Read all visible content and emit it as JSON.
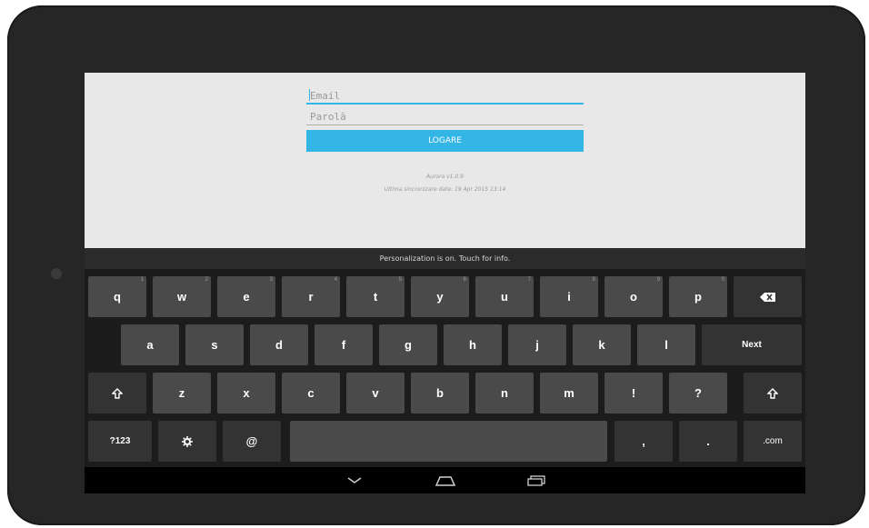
{
  "login": {
    "email_placeholder": "Email",
    "password_placeholder": "Parolă",
    "login_button": "LOGARE",
    "version": "Aurora v1.0.9",
    "last_sync": "Ultima sincronizare date: 19 Apr 2015 13:14"
  },
  "keyboard": {
    "suggestion_strip": "Personalization is on. Touch for info.",
    "row1": [
      {
        "label": "q",
        "hint": "1"
      },
      {
        "label": "w",
        "hint": "2"
      },
      {
        "label": "e",
        "hint": "3"
      },
      {
        "label": "r",
        "hint": "4"
      },
      {
        "label": "t",
        "hint": "5"
      },
      {
        "label": "y",
        "hint": "6"
      },
      {
        "label": "u",
        "hint": "7"
      },
      {
        "label": "i",
        "hint": "8"
      },
      {
        "label": "o",
        "hint": "9"
      },
      {
        "label": "p",
        "hint": "0"
      }
    ],
    "row2": [
      "a",
      "s",
      "d",
      "f",
      "g",
      "h",
      "j",
      "k",
      "l"
    ],
    "row3": [
      "z",
      "x",
      "c",
      "v",
      "b",
      "n",
      "m",
      "!",
      "?"
    ],
    "next_label": "Next",
    "symbols_label": "?123",
    "at_label": "@",
    "comma_label": ",",
    "period_label": ".",
    "dotcom_label": ".com",
    "backspace_icon": "backspace-icon",
    "shift_icon": "shift-icon",
    "settings_icon": "gear-icon"
  },
  "navbar": {
    "back_icon": "back-chevron-icon",
    "home_icon": "home-icon",
    "recents_icon": "recent-apps-icon"
  }
}
